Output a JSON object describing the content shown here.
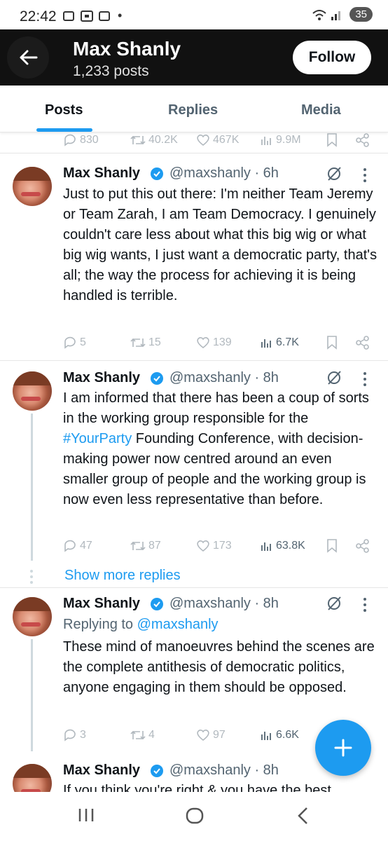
{
  "status_bar": {
    "time": "22:42",
    "battery": "35"
  },
  "header": {
    "name": "Max Shanly",
    "post_count": "1,233 posts",
    "follow_label": "Follow"
  },
  "tabs": [
    {
      "label": "Posts"
    },
    {
      "label": "Replies"
    },
    {
      "label": "Media"
    }
  ],
  "partial_post": {
    "replies": "830",
    "reposts": "40.2K",
    "likes": "467K",
    "views": "9.9M"
  },
  "posts": [
    {
      "name": "Max Shanly",
      "handle": "@maxshanly · 6h",
      "text": "Just to put this out there: I'm neither Team Jeremy or Team Zarah, I am Team Democracy. I genuinely couldn't care less about what this big wig or what big wig wants, I just want a democratic party, that's all; the way the process for achieving it is being handled is terrible.",
      "replies": "5",
      "reposts": "15",
      "likes": "139",
      "views": "6.7K"
    },
    {
      "name": "Max Shanly",
      "handle": "@maxshanly · 8h",
      "text_before": "I am informed that there has been a coup of sorts in the working group responsible for the ",
      "hashtag": "#YourParty",
      "text_after": " Founding Conference, with decision-making power now centred around an even smaller group of people and the working group is now even less representative than before.",
      "replies": "47",
      "reposts": "87",
      "likes": "173",
      "views": "63.8K"
    },
    {
      "name": "Max Shanly",
      "handle": "@maxshanly · 8h",
      "reply_prefix": "Replying to ",
      "reply_to": "@maxshanly",
      "text": "These mind of manoeuvres behind the scenes are the complete antithesis of democratic politics, anyone engaging in them should be opposed.",
      "replies": "3",
      "reposts": "4",
      "likes": "97",
      "views": "6.6K"
    },
    {
      "name": "Max Shanly",
      "handle": "@maxshanly · 8h",
      "text": "If you think you're right & you have the best"
    }
  ],
  "show_more_label": "Show more replies",
  "colors": {
    "accent": "#1d9bf0",
    "verified": "#1d9bf0",
    "header_bg": "#111111"
  }
}
